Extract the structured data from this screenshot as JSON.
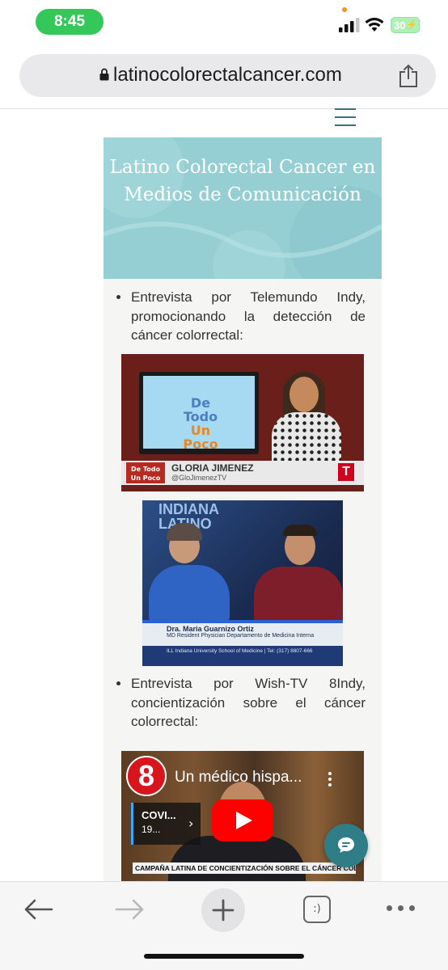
{
  "status_bar": {
    "time": "8:45",
    "battery": "30"
  },
  "browser": {
    "url": "latinocolorectalcancer.com"
  },
  "page": {
    "banner_title": "Latino Colorectal Cancer en Medios de Comunicación",
    "item_1": "Entrevista por Telemundo Indy, promocionando la detección de cáncer colorrectal:",
    "item_2": "Entrevista por Wish-TV 8Indy, concientización sobre el cáncer colorrectal:"
  },
  "video_telemundo": {
    "screen_logo_top": "De Todo",
    "screen_logo_bottom": "Un Poco",
    "show_logo": "De Todo Un Poco",
    "presenter_name": "GLORIA JIMENEZ",
    "presenter_handle": "@GloJimenezTV",
    "network_mark": "T"
  },
  "photo_indiana": {
    "sign": "INDIANA LATINO",
    "guest_name": "Dra. Maria Guarnizo Ortiz",
    "guest_role": "MD Resident Physician Departamento de Medicina Interna",
    "footer": "ILL Indiana University School of Medicine | Tel: (317) 8807-666"
  },
  "video_wish": {
    "channel_logo": "8",
    "title": "Un médico hispa...",
    "card_title": "COVI...",
    "card_sub": "19...",
    "ticker": "CAMPAÑA LATINA DE CONCIENTIZACIÓN SOBRE EL CÁNCER COLORRECTAL"
  },
  "toolbar": {
    "tabs_label": ":)"
  },
  "colors": {
    "banner": "#95cfd4",
    "accent": "#2f7d86",
    "status_green": "#34c759"
  },
  "icons": [
    "lock-icon",
    "share-icon",
    "menu-icon",
    "chat-icon",
    "back-arrow-icon",
    "forward-arrow-icon",
    "plus-icon",
    "tabs-icon",
    "more-icon"
  ]
}
